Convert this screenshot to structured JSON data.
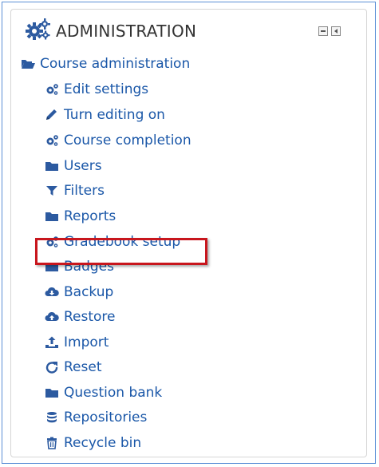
{
  "block": {
    "title": "ADMINISTRATION",
    "header_icon": "gears-icon",
    "controls": [
      "hide-block-icon",
      "dock-block-icon"
    ]
  },
  "tree": {
    "root": {
      "label": "Course administration",
      "icon": "folder-open-icon"
    },
    "items": [
      {
        "label": "Edit settings",
        "icon": "gear-icon"
      },
      {
        "label": "Turn editing on",
        "icon": "pencil-icon"
      },
      {
        "label": "Course completion",
        "icon": "gear-icon"
      },
      {
        "label": "Users",
        "icon": "folder-icon"
      },
      {
        "label": "Filters",
        "icon": "filter-icon"
      },
      {
        "label": "Reports",
        "icon": "folder-icon"
      },
      {
        "label": "Gradebook setup",
        "icon": "gear-icon",
        "highlighted": true
      },
      {
        "label": "Badges",
        "icon": "folder-icon"
      },
      {
        "label": "Backup",
        "icon": "cloud-download-icon"
      },
      {
        "label": "Restore",
        "icon": "cloud-upload-icon"
      },
      {
        "label": "Import",
        "icon": "upload-icon"
      },
      {
        "label": "Reset",
        "icon": "reset-icon"
      },
      {
        "label": "Question bank",
        "icon": "folder-icon"
      },
      {
        "label": "Repositories",
        "icon": "database-icon"
      },
      {
        "label": "Recycle bin",
        "icon": "trash-icon"
      }
    ]
  },
  "colors": {
    "link": "#1a57a8",
    "icon": "#2c5aa0",
    "highlight_border": "#c8161d",
    "outer_border": "#5b8fd6"
  }
}
